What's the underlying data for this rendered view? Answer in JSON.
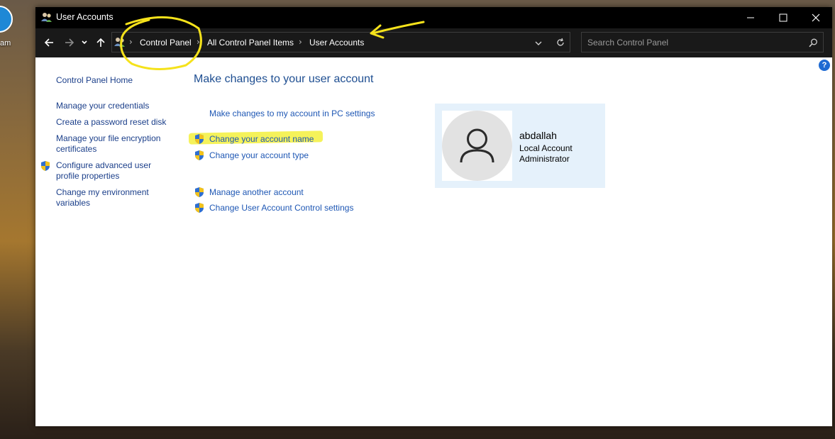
{
  "desktop": {
    "icon_label": "am"
  },
  "window": {
    "title": "User Accounts",
    "buttons": {
      "minimize": "minimize",
      "maximize": "maximize",
      "close": "close"
    }
  },
  "navigation": {
    "breadcrumbs": [
      "Control Panel",
      "All Control Panel Items",
      "User Accounts"
    ],
    "search_placeholder": "Search Control Panel"
  },
  "sidebar": {
    "home": "Control Panel Home",
    "links": [
      "Manage your credentials",
      "Create a password reset disk",
      "Manage your file encryption certificates",
      "Configure advanced user profile properties",
      "Change my environment variables"
    ]
  },
  "main": {
    "heading": "Make changes to your user account",
    "tasks": [
      "Make changes to my account in PC settings",
      "Change your account name",
      "Change your account type"
    ],
    "other_tasks": [
      "Manage another account",
      "Change User Account Control settings"
    ]
  },
  "account": {
    "name": "abdallah",
    "type": "Local Account",
    "role": "Administrator"
  },
  "colors": {
    "link": "#1e57b4",
    "heading": "#1e4e91",
    "highlight": "#f5f25a",
    "annotation": "#f5e21b",
    "card": "#e5f1fb"
  },
  "help": "?"
}
